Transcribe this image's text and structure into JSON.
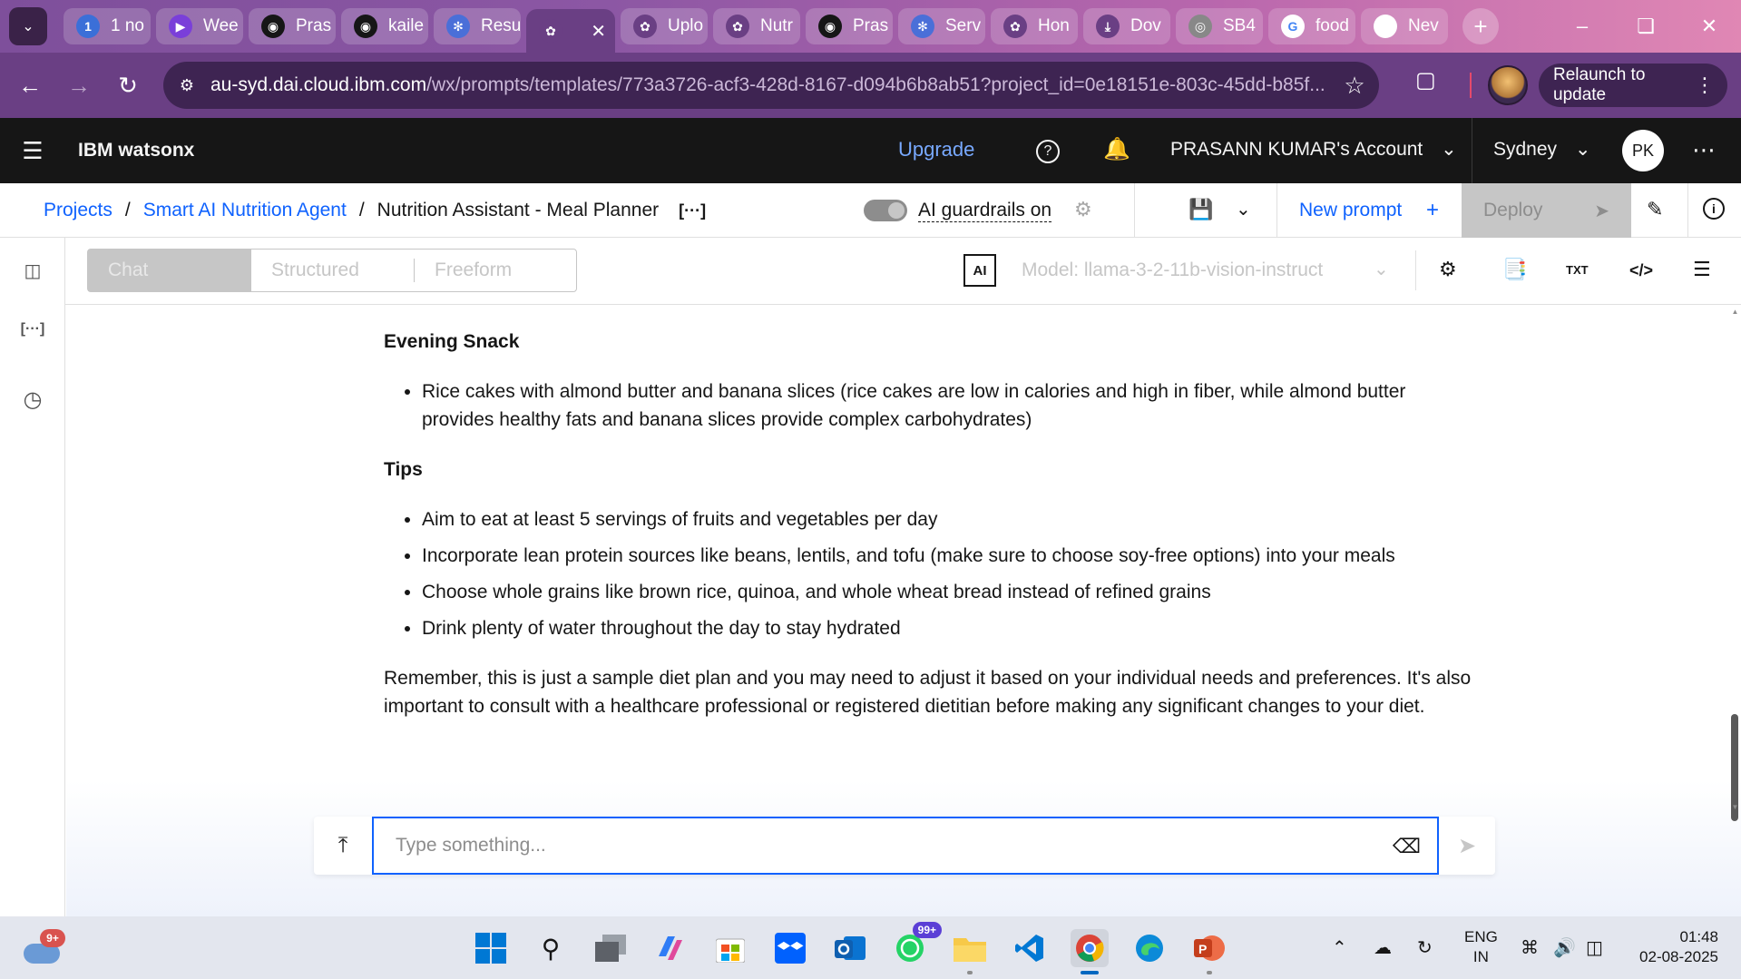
{
  "browser": {
    "tabs": [
      {
        "label": "1 no",
        "icon": "1",
        "color": "#3b6fd8"
      },
      {
        "label": "Wee",
        "icon": "▶",
        "color": "#7a3fd9"
      },
      {
        "label": "Pras",
        "icon": "github-icon",
        "color": "#161616"
      },
      {
        "label": "kaile",
        "icon": "github-icon",
        "color": "#161616"
      },
      {
        "label": "Resu",
        "icon": "ibm-icon",
        "color": "#4a6fd8"
      },
      {
        "label": "",
        "icon": "openai-icon",
        "color": "#6a3f84",
        "active": true
      },
      {
        "label": "Uplo",
        "icon": "openai-icon",
        "color": "#6a3f84"
      },
      {
        "label": "Nutr",
        "icon": "openai-icon",
        "color": "#6a3f84"
      },
      {
        "label": "Pras",
        "icon": "github-icon",
        "color": "#161616"
      },
      {
        "label": "Serv",
        "icon": "ibm-icon",
        "color": "#4a6fd8"
      },
      {
        "label": "Hon",
        "icon": "openai-icon",
        "color": "#6a3f84"
      },
      {
        "label": "Dov",
        "icon": "download-icon",
        "color": "#6a3f84"
      },
      {
        "label": "SB4",
        "icon": "globe-icon",
        "color": "#888"
      },
      {
        "label": "food",
        "icon": "google-icon",
        "color": "#fff"
      },
      {
        "label": "Nev",
        "icon": "chrome-icon",
        "color": "#fff"
      }
    ],
    "url_main": "au-syd.dai.cloud.ibm.com",
    "url_path": "/wx/prompts/templates/773a3726-acf3-428d-8167-d094b6b8ab51?project_id=0e18151e-803c-45dd-b85f...",
    "relaunch_label": "Relaunch to update"
  },
  "header": {
    "brand": "IBM watsonx",
    "upgrade": "Upgrade",
    "account": "PRASANN KUMAR's Account",
    "region": "Sydney",
    "avatar_initials": "PK"
  },
  "toolbar": {
    "breadcrumb": {
      "projects": "Projects",
      "project": "Smart AI Nutrition Agent",
      "current": "Nutrition Assistant - Meal Planner"
    },
    "guardrails_label": "AI guardrails on",
    "new_prompt": "New prompt",
    "deploy": "Deploy"
  },
  "modebar": {
    "modes": [
      "Chat",
      "Structured",
      "Freeform"
    ],
    "ai_badge": "AI",
    "model": "Model: llama-3-2-11b-vision-instruct",
    "txt_label": "TXT"
  },
  "content": {
    "evening_heading": "Evening Snack",
    "evening_items": [
      "Rice cakes with almond butter and banana slices (rice cakes are low in calories and high in fiber, while almond butter provides healthy fats and banana slices provide complex carbohydrates)"
    ],
    "tips_heading": "Tips",
    "tips_items": [
      "Aim to eat at least 5 servings of fruits and vegetables per day",
      "Incorporate lean protein sources like beans, lentils, and tofu (make sure to choose soy-free options) into your meals",
      "Choose whole grains like brown rice, quinoa, and whole wheat bread instead of refined grains",
      "Drink plenty of water throughout the day to stay hydrated"
    ],
    "closing": "Remember, this is just a sample diet plan and you may need to adjust it based on your individual needs and preferences. It's also important to consult with a healthcare professional or registered dietitian before making any significant changes to your diet."
  },
  "chat": {
    "placeholder": "Type something..."
  },
  "taskbar": {
    "weather_badge": "9+",
    "whatsapp_badge": "99+",
    "lang_line1": "ENG",
    "lang_line2": "IN",
    "time": "01:48",
    "date": "02-08-2025"
  },
  "colors": {
    "accent": "#0f62fe",
    "header_bg": "#161616",
    "browser_frame": "#6a3f84"
  }
}
